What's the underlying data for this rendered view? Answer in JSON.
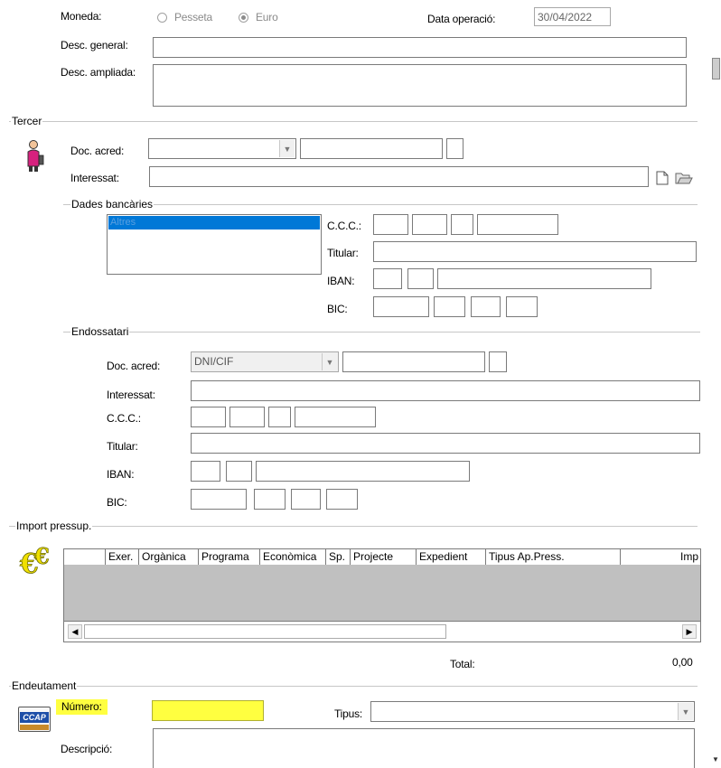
{
  "header": {
    "moneda_label": "Moneda:",
    "radio_pesseta": "Pesseta",
    "radio_euro": "Euro",
    "data_operacio_label": "Data operació:",
    "data_operacio_value": "30/04/2022",
    "desc_general_label": "Desc. general:",
    "desc_ampliada_label": "Desc. ampliada:"
  },
  "tercer": {
    "group_title": "Tercer",
    "doc_acred_label": "Doc. acred:",
    "interessat_label": "Interessat:",
    "bank": {
      "group_title": "Dades bancàries",
      "list_selected": "Altres",
      "ccc_label": "C.C.C.:",
      "titular_label": "Titular:",
      "iban_label": "IBAN:",
      "bic_label": "BIC:"
    }
  },
  "endossatari": {
    "group_title": "Endossatari",
    "doc_acred_label": "Doc. acred:",
    "doc_acred_value": "DNI/CIF",
    "interessat_label": "Interessat:",
    "ccc_label": "C.C.C.:",
    "titular_label": "Titular:",
    "iban_label": "IBAN:",
    "bic_label": "BIC:"
  },
  "import_pressup": {
    "group_title": "Import pressup.",
    "columns": [
      "Exer.",
      "Orgànica",
      "Programa",
      "Econòmica",
      "Sp.",
      "Projecte",
      "Expedient",
      "Tipus Ap.Press.",
      "Imp"
    ],
    "total_label": "Total:",
    "total_value": "0,00"
  },
  "endeutament": {
    "group_title": "Endeutament",
    "numero_label": "Número:",
    "tipus_label": "Tipus:",
    "descripcio_label": "Descripció:",
    "icon_text": "CCAP"
  },
  "colors": {
    "highlight": "#ffff40",
    "selection": "#0078d7",
    "grid_body": "#c0c0c0"
  }
}
